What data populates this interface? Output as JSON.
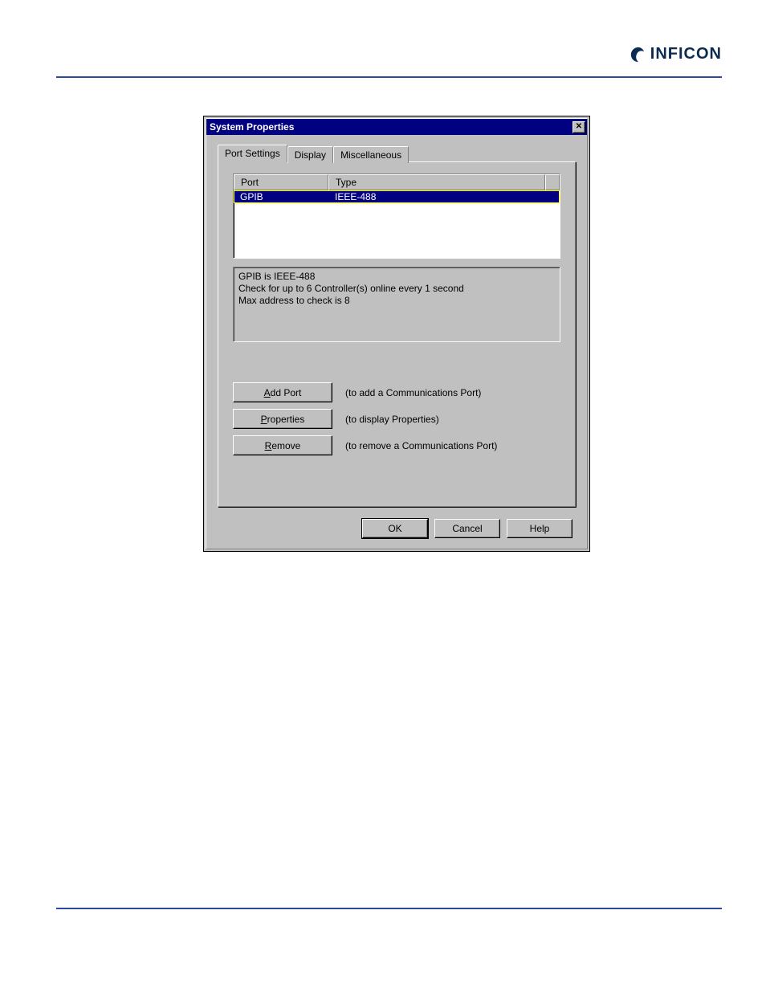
{
  "brand": {
    "name": "INFICON"
  },
  "dialog": {
    "title": "System Properties",
    "tabs": [
      {
        "label": "Port Settings",
        "active": true
      },
      {
        "label": "Display",
        "active": false
      },
      {
        "label": "Miscellaneous",
        "active": false
      }
    ],
    "listview": {
      "headers": {
        "port": "Port",
        "type": "Type"
      },
      "rows": [
        {
          "port": "GPIB",
          "type": "IEEE-488",
          "selected": true
        }
      ]
    },
    "info": {
      "line1": "GPIB is IEEE-488",
      "line2": "Check for up to 6 Controller(s) online every 1 second",
      "line3": "Max address to check is 8"
    },
    "actions": {
      "add": {
        "label_pre": "",
        "mnemonic": "A",
        "label_post": "dd Port",
        "desc": "(to add a Communications Port)"
      },
      "properties": {
        "label_pre": "",
        "mnemonic": "P",
        "label_post": "roperties",
        "desc": "(to display Properties)"
      },
      "remove": {
        "label_pre": "",
        "mnemonic": "R",
        "label_post": "emove",
        "desc": "(to remove a Communications Port)"
      }
    },
    "buttons": {
      "ok": "OK",
      "cancel": "Cancel",
      "help": "Help"
    }
  }
}
